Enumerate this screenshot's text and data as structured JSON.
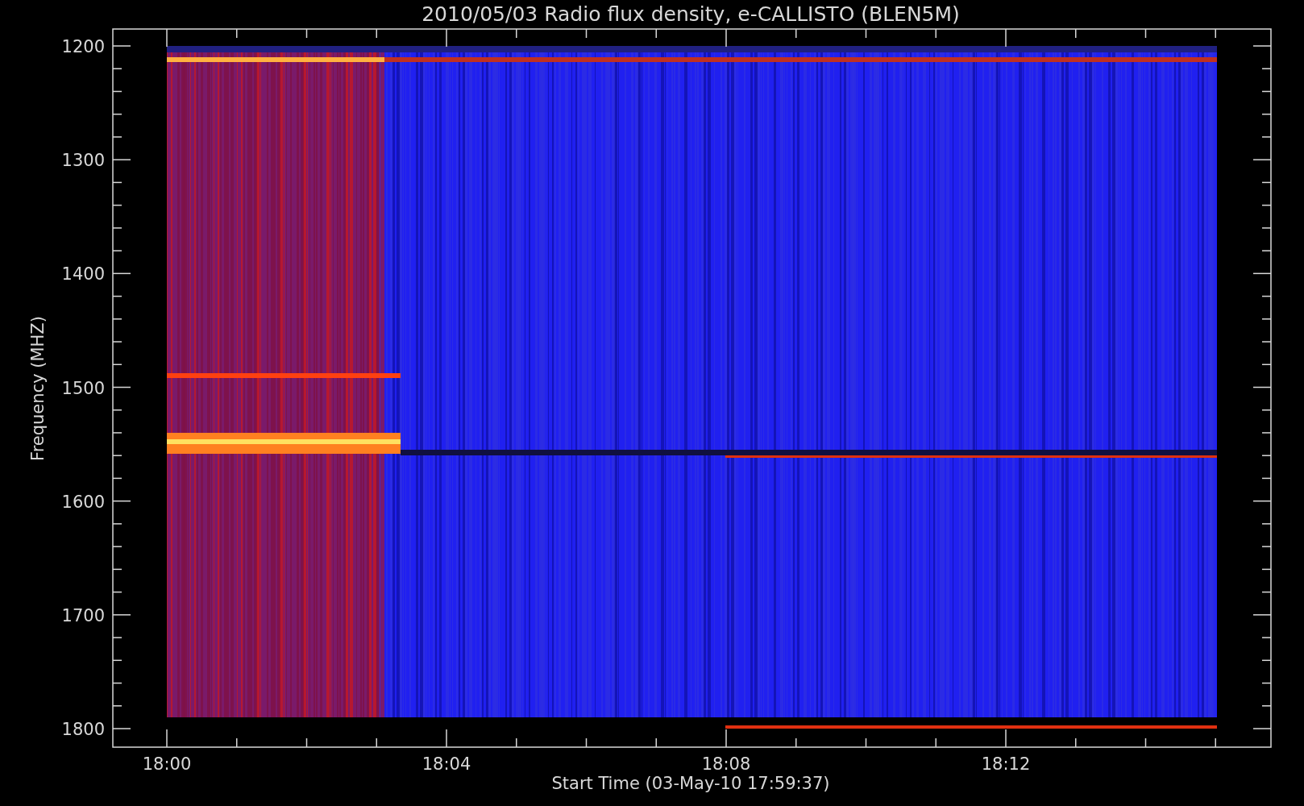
{
  "title": "2010/05/03  Radio flux density, e-CALLISTO (BLEN5M)",
  "ylabel": "Frequency (MHZ)",
  "xlabel": "Start Time (03-May-10 17:59:37)",
  "yticks": [
    "1200",
    "1300",
    "1400",
    "1500",
    "1600",
    "1700",
    "1800"
  ],
  "xticks": [
    "18:00",
    "18:04",
    "18:08",
    "18:12"
  ]
}
